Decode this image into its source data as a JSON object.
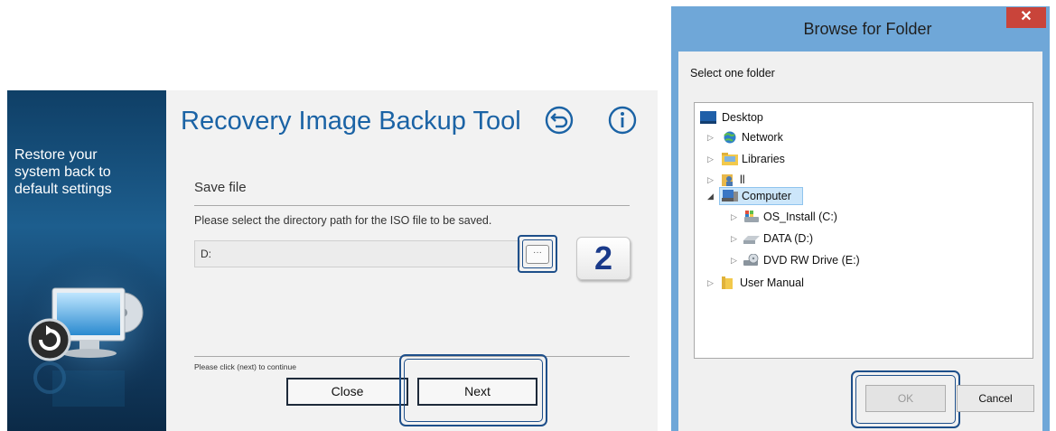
{
  "app": {
    "title": "Recovery Image Backup Tool",
    "sidebar_lines": [
      "Restore your",
      "system back to",
      "default settings"
    ],
    "icons": {
      "back": "back-arrow-circle-icon",
      "info": "info-circle-icon"
    },
    "section_title": "Save file",
    "instruction": "Please select the directory path for the ISO file to be saved.",
    "path_value": "D:",
    "browse_label": "···",
    "step_number": "2",
    "footer_note": "Please click (next) to continue",
    "close_label": "Close",
    "next_label": "Next",
    "colors": {
      "title": "#1b63a5",
      "sidebar": "#1d5e8e"
    }
  },
  "dialog": {
    "title": "Browse for Folder",
    "close_glyph": "✕",
    "prompt": "Select one folder",
    "tree": [
      {
        "label": "Desktop",
        "icon": "desktop-icon"
      },
      {
        "label": "Network",
        "icon": "network-icon"
      },
      {
        "label": "Libraries",
        "icon": "libraries-folder-icon"
      },
      {
        "label": "ll",
        "icon": "user-folder-icon"
      },
      {
        "label": "Computer",
        "icon": "computer-icon",
        "selected": true
      },
      {
        "label": "OS_Install (C:)",
        "icon": "os-drive-icon"
      },
      {
        "label": "DATA (D:)",
        "icon": "hard-drive-icon"
      },
      {
        "label": "DVD RW Drive (E:)",
        "icon": "dvd-drive-icon"
      },
      {
        "label": "User Manual",
        "icon": "folder-icon"
      }
    ],
    "ok_label": "OK",
    "cancel_label": "Cancel",
    "colors": {
      "frame": "#6fa7d8",
      "close": "#c9443a",
      "selection": "#cce6fa"
    }
  }
}
